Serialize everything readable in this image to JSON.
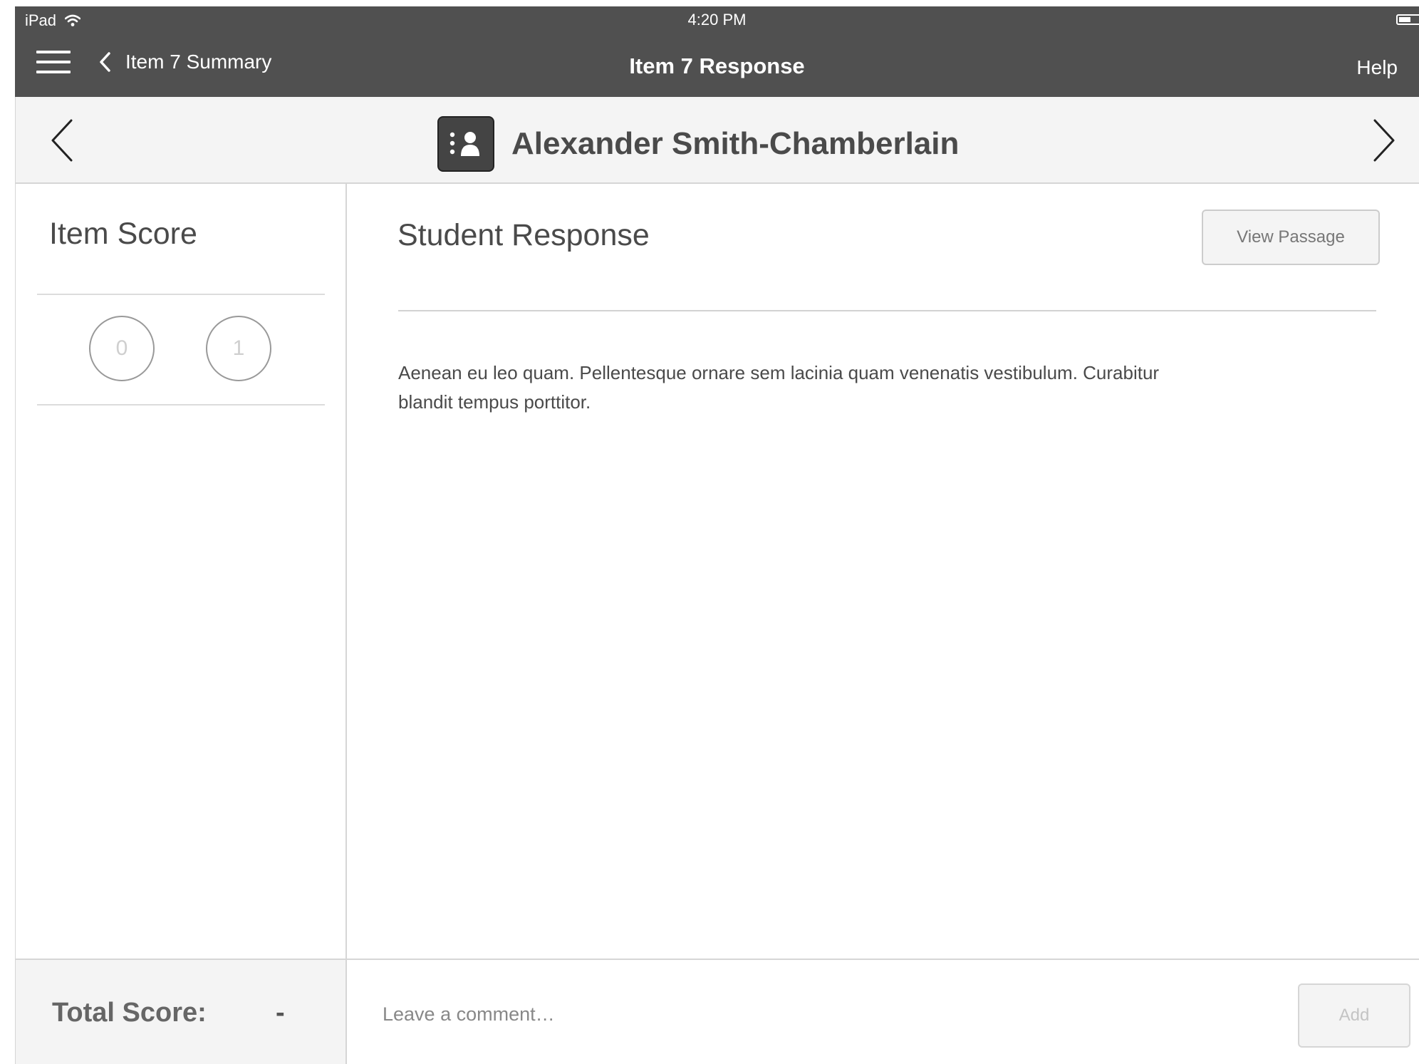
{
  "status_bar": {
    "device": "iPad",
    "time": "4:20 PM",
    "wifi_icon": "wifi-icon",
    "battery_icon": "battery-icon"
  },
  "nav": {
    "menu_icon": "hamburger-menu-icon",
    "back_icon": "chevron-left-icon",
    "back_label": "Item 7 Summary",
    "title": "Item 7 Response",
    "help_label": "Help"
  },
  "student": {
    "name": "Alexander Smith-Chamberlain",
    "avatar_icon": "student-list-icon",
    "prev_icon": "chevron-left-icon",
    "next_icon": "chevron-right-icon"
  },
  "item_score": {
    "title": "Item Score",
    "options": [
      "0",
      "1"
    ]
  },
  "student_response": {
    "title": "Student Response",
    "view_passage_label": "View Passage",
    "text": "Aenean eu leo quam. Pellentesque ornare sem lacinia quam venenatis vestibulum. Curabitur blandit tempus porttitor."
  },
  "footer": {
    "total_label": "Total Score:",
    "total_value": "-",
    "comment_placeholder": "Leave a comment…",
    "add_label": "Add"
  },
  "colors": {
    "top_bar": "#505050",
    "header_bg": "#f4f4f4",
    "text_dark": "#4a4a4a",
    "border": "#d6d6d6"
  }
}
